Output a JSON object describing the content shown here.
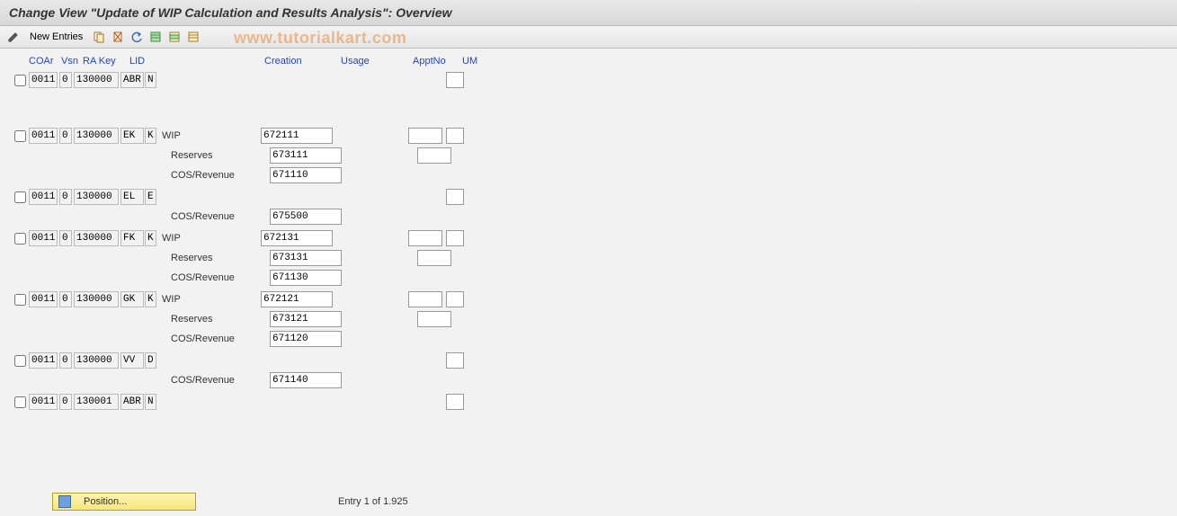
{
  "title": "Change View \"Update of WIP Calculation and Results Analysis\": Overview",
  "toolbar": {
    "new_entries": "New Entries"
  },
  "watermark": "www.tutorialkart.com",
  "headers": {
    "coar": "COAr",
    "vsn": "Vsn",
    "rakey": "RA Key",
    "lid": "LID",
    "creation": "Creation",
    "usage": "Usage",
    "apptno": "ApptNo",
    "um": "UM"
  },
  "labels": {
    "wip": "WIP",
    "reserves": "Reserves",
    "cosrev": "COS/Revenue"
  },
  "rows": [
    {
      "coar": "0011",
      "vsn": "0",
      "rakey": "130000",
      "lid": "ABR",
      "lid2": "N",
      "details": [
        {
          "label": "",
          "creation": "",
          "appt": false,
          "um": true
        }
      ]
    },
    {
      "coar": "0011",
      "vsn": "0",
      "rakey": "130000",
      "lid": "EK",
      "lid2": "K",
      "details": [
        {
          "label": "wip",
          "creation": "672111",
          "appt": true,
          "um": true
        },
        {
          "label": "reserves",
          "creation": "673111",
          "appt": true,
          "um": false
        },
        {
          "label": "cosrev",
          "creation": "671110",
          "appt": false,
          "um": false
        }
      ]
    },
    {
      "coar": "0011",
      "vsn": "0",
      "rakey": "130000",
      "lid": "EL",
      "lid2": "E",
      "details": [
        {
          "label": "",
          "creation": "",
          "appt": false,
          "um": true
        },
        {
          "label": "cosrev",
          "creation": "675500",
          "appt": false,
          "um": false
        }
      ]
    },
    {
      "coar": "0011",
      "vsn": "0",
      "rakey": "130000",
      "lid": "FK",
      "lid2": "K",
      "details": [
        {
          "label": "wip",
          "creation": "672131",
          "appt": true,
          "um": true
        },
        {
          "label": "reserves",
          "creation": "673131",
          "appt": true,
          "um": false
        },
        {
          "label": "cosrev",
          "creation": "671130",
          "appt": false,
          "um": false
        }
      ]
    },
    {
      "coar": "0011",
      "vsn": "0",
      "rakey": "130000",
      "lid": "GK",
      "lid2": "K",
      "details": [
        {
          "label": "wip",
          "creation": "672121",
          "appt": true,
          "um": true
        },
        {
          "label": "reserves",
          "creation": "673121",
          "appt": true,
          "um": false
        },
        {
          "label": "cosrev",
          "creation": "671120",
          "appt": false,
          "um": false
        }
      ]
    },
    {
      "coar": "0011",
      "vsn": "0",
      "rakey": "130000",
      "lid": "VV",
      "lid2": "D",
      "details": [
        {
          "label": "",
          "creation": "",
          "appt": false,
          "um": true
        },
        {
          "label": "cosrev",
          "creation": "671140",
          "appt": false,
          "um": false
        }
      ]
    },
    {
      "coar": "0011",
      "vsn": "0",
      "rakey": "130001",
      "lid": "ABR",
      "lid2": "N",
      "details": [
        {
          "label": "",
          "creation": "",
          "appt": false,
          "um": true
        }
      ]
    }
  ],
  "footer": {
    "position": "Position...",
    "entry_text": "Entry 1 of 1.925"
  }
}
